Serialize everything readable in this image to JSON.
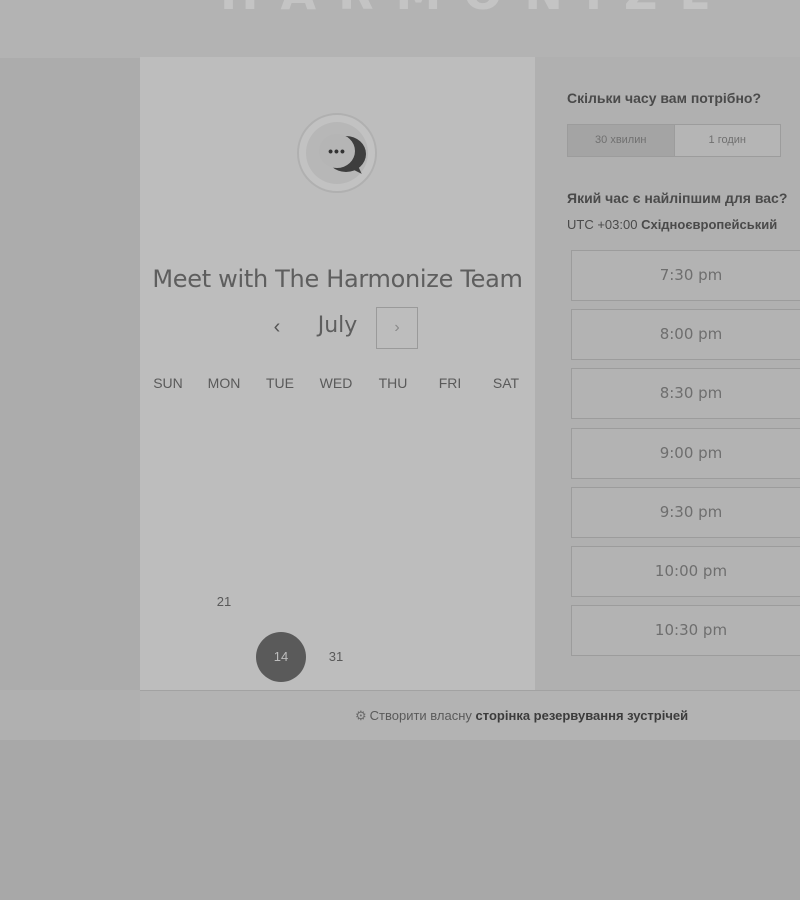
{
  "background": {
    "logo_text": "HARMONIZE"
  },
  "calendar": {
    "title": "Meet with The Harmonize Team",
    "month": "July",
    "prev_glyph": "‹",
    "next_glyph": "›",
    "weekdays": [
      "SUN",
      "MON",
      "TUE",
      "WED",
      "THU",
      "FRI",
      "SAT"
    ],
    "visible_days": [
      "21",
      "14",
      "31"
    ],
    "selected_day": "14"
  },
  "booking": {
    "duration_question": "Скільки часу вам потрібно?",
    "duration_options": [
      "30 хвилин",
      "1 годин"
    ],
    "selected_duration": "30 хвилин",
    "time_question": "Який час є найліпшим для вас?",
    "timezone_offset": "UTC +03:00",
    "timezone_name": "Східноєвропейський",
    "time_slots": [
      "7:30 pm",
      "8:00 pm",
      "8:30 pm",
      "9:00 pm",
      "9:30 pm",
      "10:00 pm",
      "10:30 pm"
    ]
  },
  "footer": {
    "link_prefix": "Створити власну",
    "link_bold": "сторінка резервування зустрічей"
  },
  "icons": {
    "avatar": "chat-bubble-icon",
    "footer": "sprocket-icon"
  },
  "colors": {
    "overlay_background": "#a8a8a8",
    "card": "#bdbdbd",
    "selected_day": "#5a5a5a"
  }
}
